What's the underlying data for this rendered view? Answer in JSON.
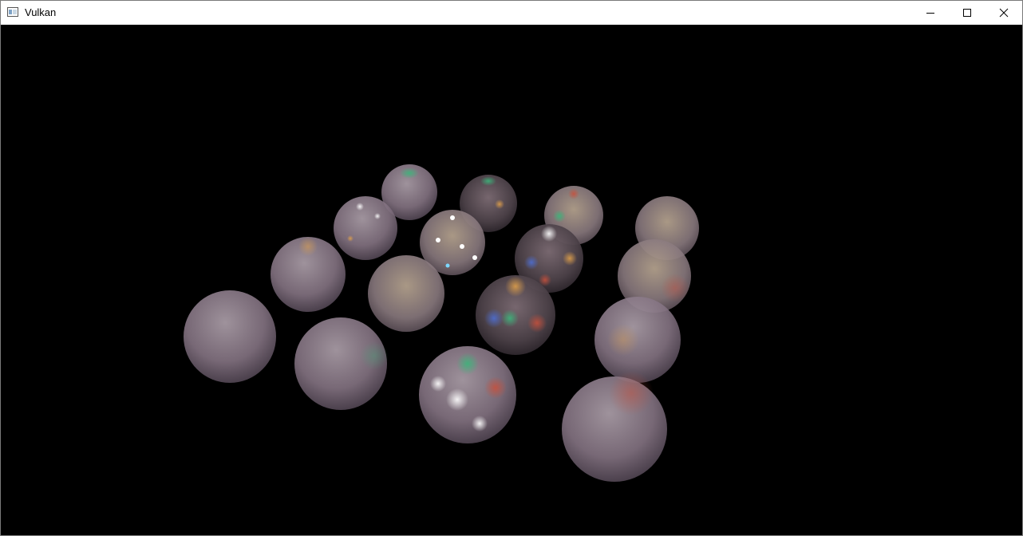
{
  "window": {
    "title": "Vulkan",
    "icons": {
      "app": "app-window-icon",
      "minimize": "minimize-icon",
      "maximize": "maximize-icon",
      "close": "close-icon"
    }
  },
  "scene": {
    "background": "#000000",
    "object_count": 16,
    "object_kind": "translucent spheres with colored light highlights",
    "colors": {
      "sphere_base": "#8f7e8c",
      "highlight_green": "#3db37a",
      "highlight_orange": "#e3a24a",
      "highlight_red": "#c8503c",
      "highlight_blue": "#4d6fd6"
    }
  }
}
